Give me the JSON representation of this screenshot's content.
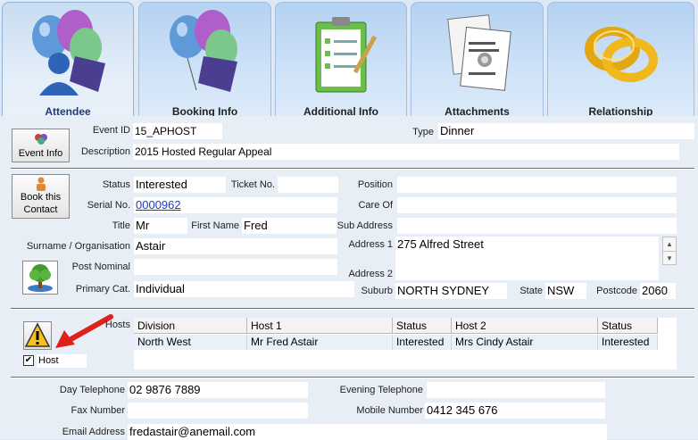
{
  "tabs": [
    {
      "label": "Attendee",
      "active": true,
      "icon": "balloons-person-icon"
    },
    {
      "label": "Booking Info",
      "active": false,
      "icon": "balloons-ticket-icon"
    },
    {
      "label": "Additional Info",
      "active": false,
      "icon": "clipboard-checklist-icon"
    },
    {
      "label": "Attachments",
      "active": false,
      "icon": "documents-pin-icon"
    },
    {
      "label": "Relationship",
      "active": false,
      "icon": "rings-icon"
    }
  ],
  "event": {
    "button_label": "Event Info",
    "event_id_label": "Event ID",
    "event_id": "15_APHOST",
    "type_label": "Type",
    "type": "Dinner",
    "description_label": "Description",
    "description": "2015 Hosted Regular Appeal"
  },
  "contact": {
    "book_button_line1": "Book this",
    "book_button_line2": "Contact",
    "status_label": "Status",
    "status": "Interested",
    "ticket_label": "Ticket No.",
    "ticket": "",
    "position_label": "Position",
    "position": "",
    "serial_label": "Serial No.",
    "serial": "0000962",
    "care_of_label": "Care Of",
    "care_of": "",
    "title_label": "Title",
    "title": "Mr",
    "first_name_label": "First Name",
    "first_name": "Fred",
    "sub_address_label": "Sub Address",
    "sub_address": "",
    "surname_label": "Surname / Organisation",
    "surname": "Astair",
    "address1_label": "Address 1",
    "address1": "275 Alfred Street",
    "post_nominal_label": "Post Nominal",
    "post_nominal": "",
    "address2_label": "Address 2",
    "address2": "",
    "primary_cat_label": "Primary Cat.",
    "primary_cat": "Individual",
    "suburb_label": "Suburb",
    "suburb": "NORTH SYDNEY",
    "state_label": "State",
    "state": "NSW",
    "postcode_label": "Postcode",
    "postcode": "2060"
  },
  "hosts": {
    "label": "Hosts",
    "host_checkbox_label": "Host",
    "host_checked": true,
    "columns": [
      "Division",
      "Host 1",
      "Status",
      "Host 2",
      "Status"
    ],
    "rows": [
      [
        "North West",
        "Mr Fred Astair",
        "Interested",
        "Mrs Cindy Astair",
        "Interested"
      ]
    ]
  },
  "phones": {
    "day_label": "Day Telephone",
    "day": "02 9876 7889",
    "evening_label": "Evening Telephone",
    "evening": "",
    "fax_label": "Fax Number",
    "fax": "",
    "mobile_label": "Mobile Number",
    "mobile": "0412 345 676",
    "email_label": "Email Address",
    "email": "fredastair@anemail.com"
  },
  "colors": {
    "accent": "#1d3c7a",
    "link": "#1a3ec7",
    "arrow": "#e0201b",
    "tab_bg": "#cfe2f7",
    "panel": "#e8eef6"
  }
}
